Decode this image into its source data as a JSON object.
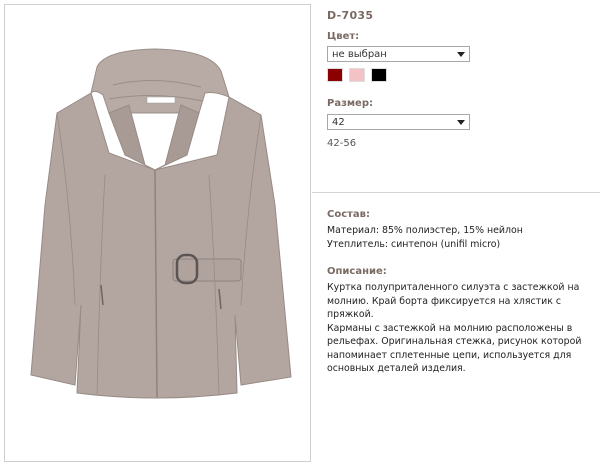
{
  "product": {
    "sku": "D-7035",
    "image_alt": "jacket-photo"
  },
  "color": {
    "label": "Цвет:",
    "selected": "не выбран",
    "swatches": [
      "#8b0000",
      "#f2c2c6",
      "#000000"
    ]
  },
  "size": {
    "label": "Размер:",
    "selected": "42",
    "range": "42-56"
  },
  "composition": {
    "label": "Состав:",
    "lines": [
      "Материал: 85% полиэстер, 15% нейлон",
      "Утеплитель: синтепон (unifil micro)"
    ]
  },
  "description": {
    "label": "Описание:",
    "lines": [
      "Куртка полуприталенного силуэта с застежкой на",
      "молнию. Край борта фиксируется на хлястик с пряжкой.",
      "Карманы с застежкой на молнию расположены в",
      "рельефах. Оригинальная стежка, рисунок которой",
      "напоминает сплетенные цепи, используется для",
      "основных деталей изделия."
    ]
  },
  "colors": {
    "accent_label": "#7a6a63",
    "jacket": "#b3a6a1"
  }
}
